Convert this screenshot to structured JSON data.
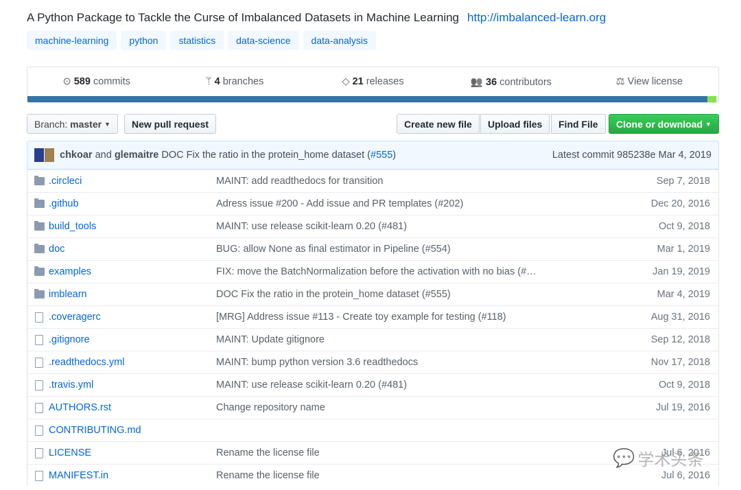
{
  "repo": {
    "description": "A Python Package to Tackle the Curse of Imbalanced Datasets in Machine Learning",
    "url": "http://imbalanced-learn.org",
    "topics": [
      "machine-learning",
      "python",
      "statistics",
      "data-science",
      "data-analysis"
    ]
  },
  "stats": [
    {
      "icon": "commit-icon",
      "count": "589",
      "label": "commits"
    },
    {
      "icon": "branch-icon",
      "count": "4",
      "label": "branches"
    },
    {
      "icon": "tag-icon",
      "count": "21",
      "label": "releases"
    },
    {
      "icon": "people-icon",
      "count": "36",
      "label": "contributors"
    },
    {
      "icon": "law-icon",
      "count": "",
      "label": "View license"
    }
  ],
  "language_bar": {
    "colors": [
      "#3572a5",
      "#89e051",
      "#ededed"
    ],
    "percent": [
      98.4,
      1.3,
      0.3
    ]
  },
  "toolbar": {
    "branch_label": "Branch:",
    "branch": "master",
    "new_pr": "New pull request",
    "create_file": "Create new file",
    "upload": "Upload files",
    "find": "Find File",
    "clone": "Clone or download"
  },
  "commit": {
    "author1": "chkoar",
    "and": "and",
    "author2": "glemaitre",
    "message": "DOC Fix the ratio in the protein_home dataset (",
    "pr": "#555",
    "close": ")",
    "latest": "Latest commit 985238e Mar 4, 2019"
  },
  "files": [
    {
      "type": "dir",
      "name": ".circleci",
      "msg": "MAINT: add readthedocs for transition",
      "age": "Sep 7, 2018"
    },
    {
      "type": "dir",
      "name": ".github",
      "msg": "Adress issue #200 - Add issue and PR templates (#202)",
      "age": "Dec 20, 2016"
    },
    {
      "type": "dir",
      "name": "build_tools",
      "msg": "MAINT: use release scikit-learn 0.20 (#481)",
      "age": "Oct 9, 2018"
    },
    {
      "type": "dir",
      "name": "doc",
      "msg": "BUG: allow None as final estimator in Pipeline (#554)",
      "age": "Mar 1, 2019"
    },
    {
      "type": "dir",
      "name": "examples",
      "msg": "FIX: move the BatchNormalization before the activation with no bias (#…",
      "age": "Jan 19, 2019"
    },
    {
      "type": "dir",
      "name": "imblearn",
      "msg": "DOC Fix the ratio in the protein_home dataset (#555)",
      "age": "Mar 4, 2019"
    },
    {
      "type": "file",
      "name": ".coveragerc",
      "msg": "[MRG] Address issue #113 - Create toy example for testing (#118)",
      "age": "Aug 31, 2016"
    },
    {
      "type": "file",
      "name": ".gitignore",
      "msg": "MAINT: Update gitignore",
      "age": "Sep 12, 2018"
    },
    {
      "type": "file",
      "name": ".readthedocs.yml",
      "msg": "MAINT: bump python version 3.6 readthedocs",
      "age": "Nov 17, 2018"
    },
    {
      "type": "file",
      "name": ".travis.yml",
      "msg": "MAINT: use release scikit-learn 0.20 (#481)",
      "age": "Oct 9, 2018"
    },
    {
      "type": "file",
      "name": "AUTHORS.rst",
      "msg": "Change repository name",
      "age": "Jul 19, 2016"
    },
    {
      "type": "file",
      "name": "CONTRIBUTING.md",
      "msg": "",
      "age": ""
    },
    {
      "type": "file",
      "name": "LICENSE",
      "msg": "Rename the license file",
      "age": "Jul 6, 2016"
    },
    {
      "type": "file",
      "name": "MANIFEST.in",
      "msg": "Rename the license file",
      "age": "Jul 6, 2016"
    }
  ],
  "watermark": "学术头条"
}
